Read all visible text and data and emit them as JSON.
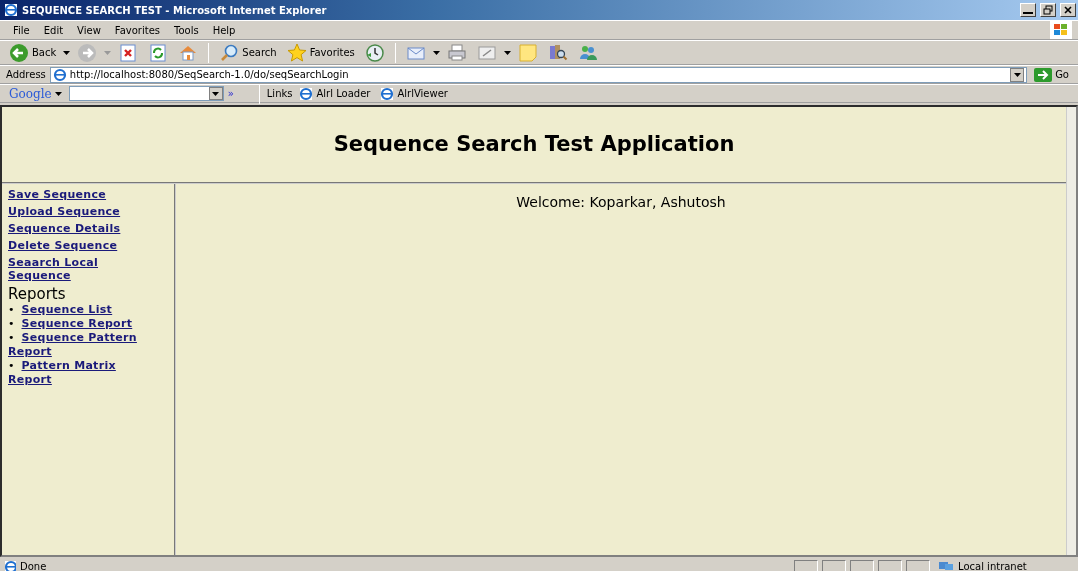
{
  "window": {
    "title": "SEQUENCE SEARCH TEST - Microsoft Internet Explorer",
    "controls": [
      {
        "kind": "minimize"
      },
      {
        "kind": "restore"
      },
      {
        "kind": "close"
      }
    ]
  },
  "menu": [
    "File",
    "Edit",
    "View",
    "Favorites",
    "Tools",
    "Help"
  ],
  "toolbar": [
    {
      "kind": "back",
      "label": "Back"
    },
    {
      "kind": "forward"
    },
    {
      "kind": "stop"
    },
    {
      "kind": "refresh"
    },
    {
      "kind": "home"
    },
    {
      "kind": "search",
      "label": "Search"
    },
    {
      "kind": "favorites",
      "label": "Favorites"
    },
    {
      "kind": "history"
    },
    {
      "kind": "mail"
    },
    {
      "kind": "print"
    },
    {
      "kind": "edit"
    },
    {
      "kind": "note"
    },
    {
      "kind": "research"
    },
    {
      "kind": "messenger"
    }
  ],
  "address": {
    "label": "Address",
    "value": "http://localhost:8080/SeqSearch-1.0/do/seqSearchLogin",
    "go": "Go"
  },
  "google_bar": {
    "logo": "Google",
    "more": "»",
    "links_label": "Links",
    "links": [
      "Alrl Loader",
      "AlrlViewer"
    ]
  },
  "page": {
    "heading": "Sequence Search Test Application",
    "welcome": "Welcome: Koparkar, Ashutosh",
    "nav": [
      "Save Sequence",
      "Upload Sequence",
      "Sequence Details",
      "Delete Sequence",
      "Seaarch Local Sequence"
    ],
    "reports_heading": "Reports",
    "reports": [
      {
        "bullet": "•",
        "label": "Sequence List"
      },
      {
        "bullet": "•",
        "label": "Sequence Report"
      },
      {
        "bullet": "•",
        "label": "Sequence Pattern Report"
      },
      {
        "bullet": "•",
        "label": "Pattern Matrix Report"
      }
    ]
  },
  "status_bar": {
    "text": "Done",
    "zone": "Local intranet"
  }
}
